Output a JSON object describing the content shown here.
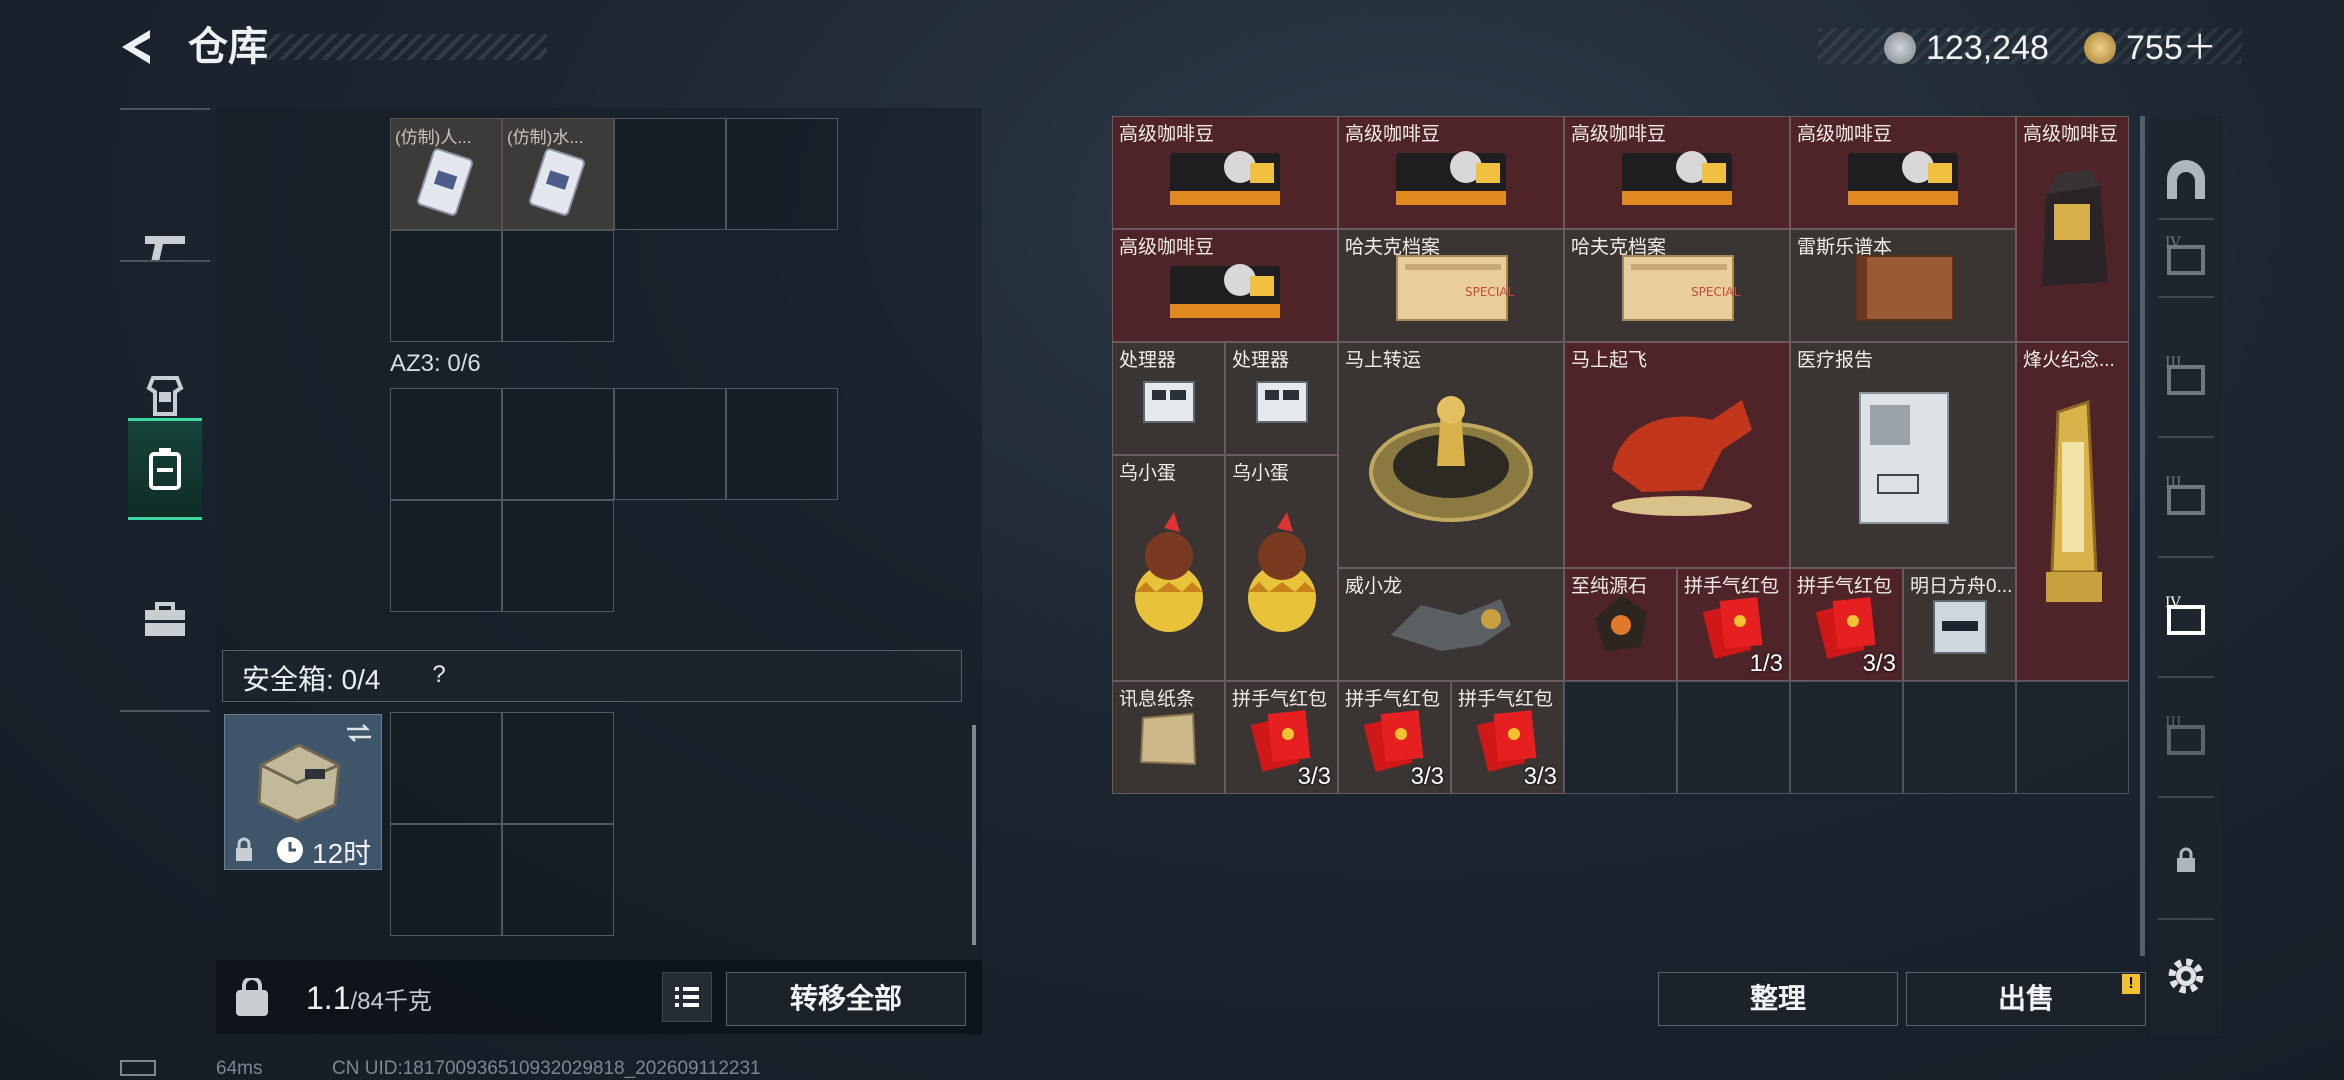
{
  "header": {
    "title": "仓库",
    "silver_value": "123,248",
    "gold_value": "755＋"
  },
  "left": {
    "top_items": [
      {
        "name": "(仿制)人..."
      },
      {
        "name": "(仿制)水..."
      }
    ],
    "az3_label": "AZ3: 0/6",
    "safe_label": "安全箱: 0/4",
    "help_mark": "?",
    "safebox_timer": "12时",
    "weight_value": "1.1",
    "weight_unit": "/84千克",
    "transfer_all": "转移全部"
  },
  "items": [
    {
      "name": "高级咖啡豆",
      "count": ""
    },
    {
      "name": "高级咖啡豆",
      "count": ""
    },
    {
      "name": "高级咖啡豆",
      "count": ""
    },
    {
      "name": "高级咖啡豆",
      "count": ""
    },
    {
      "name": "高级咖啡豆",
      "count": ""
    },
    {
      "name": "高级咖啡豆",
      "count": ""
    },
    {
      "name": "哈夫克档案",
      "count": ""
    },
    {
      "name": "哈夫克档案",
      "count": ""
    },
    {
      "name": "雷斯乐谱本",
      "count": ""
    },
    {
      "name": "处理器",
      "count": ""
    },
    {
      "name": "处理器",
      "count": ""
    },
    {
      "name": "马上转运",
      "count": ""
    },
    {
      "name": "马上起飞",
      "count": ""
    },
    {
      "name": "医疗报告",
      "count": ""
    },
    {
      "name": "烽火纪念...",
      "count": ""
    },
    {
      "name": "乌小蛋",
      "count": ""
    },
    {
      "name": "乌小蛋",
      "count": ""
    },
    {
      "name": "威小龙",
      "count": ""
    },
    {
      "name": "至纯源石",
      "count": ""
    },
    {
      "name": "拼手气红包",
      "count": "1/3"
    },
    {
      "name": "拼手气红包",
      "count": "3/3"
    },
    {
      "name": "明日方舟0...",
      "count": ""
    },
    {
      "name": "讯息纸条",
      "count": ""
    },
    {
      "name": "拼手气红包",
      "count": "3/3"
    },
    {
      "name": "拼手气红包",
      "count": "3/3"
    },
    {
      "name": "拼手气红包",
      "count": "3/3"
    }
  ],
  "buttons": {
    "sort": "整理",
    "sell": "出售"
  },
  "status": {
    "ping": "64ms",
    "uid": "CN UID:18170093651093202981​8_202609112231"
  },
  "colors": {
    "accent": "#3dd6a3",
    "red_cell": "#4e2429",
    "warning": "#f2c230"
  }
}
